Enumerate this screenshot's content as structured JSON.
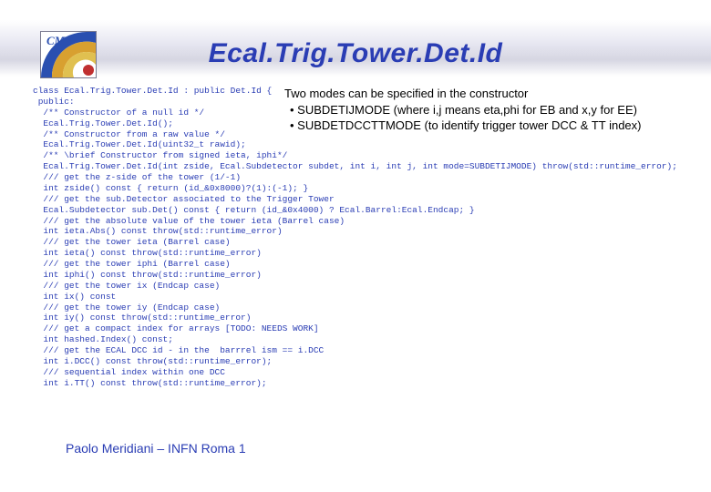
{
  "logo": {
    "label": "CMS"
  },
  "title": "Ecal.Trig.Tower.Det.Id",
  "explain": {
    "line1": "Two modes can be specified in the constructor",
    "bullet1": "• SUBDETIJMODE (where i,j means eta,phi for EB and x,y for EE)",
    "bullet2": "• SUBDETDCCTTMODE (to identify trigger tower DCC & TT index)"
  },
  "code": "class Ecal.Trig.Tower.Det.Id : public Det.Id {\n public:\n  /** Constructor of a null id */\n  Ecal.Trig.Tower.Det.Id();\n  /** Constructor from a raw value */\n  Ecal.Trig.Tower.Det.Id(uint32_t rawid);\n  /** \\brief Constructor from signed ieta, iphi*/\n  Ecal.Trig.Tower.Det.Id(int zside, Ecal.Subdetector subdet, int i, int j, int mode=SUBDETIJMODE) throw(std::runtime_error);\n  /// get the z-side of the tower (1/-1)\n  int zside() const { return (id_&0x8000)?(1):(-1); }\n  /// get the sub.Detector associated to the Trigger Tower\n  Ecal.Subdetector sub.Det() const { return (id_&0x4000) ? Ecal.Barrel:Ecal.Endcap; }\n  /// get the absolute value of the tower ieta (Barrel case)\n  int ieta.Abs() const throw(std::runtime_error)\n  /// get the tower ieta (Barrel case)\n  int ieta() const throw(std::runtime_error)\n  /// get the tower iphi (Barrel case)\n  int iphi() const throw(std::runtime_error)\n  /// get the tower ix (Endcap case)\n  int ix() const\n  /// get the tower iy (Endcap case)\n  int iy() const throw(std::runtime_error)\n  /// get a compact index for arrays [TODO: NEEDS WORK]\n  int hashed.Index() const;\n  /// get the ECAL DCC id - in the  barrrel ism == i.DCC\n  int i.DCC() const throw(std::runtime_error);\n  /// sequential index within one DCC\n  int i.TT() const throw(std::runtime_error);",
  "footer": "Paolo Meridiani – INFN Roma 1"
}
